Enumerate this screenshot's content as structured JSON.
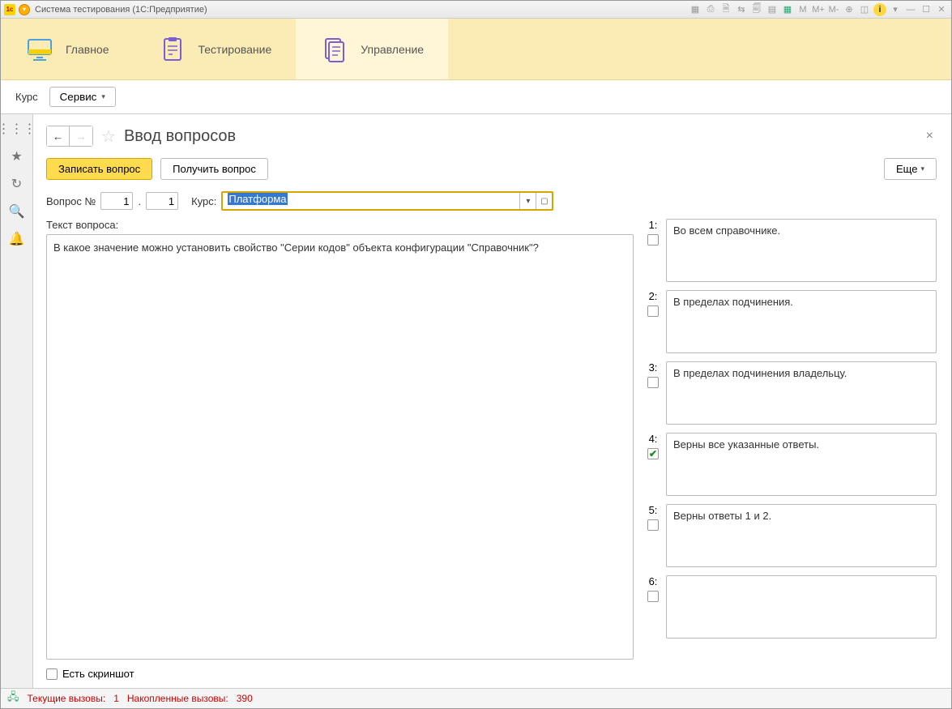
{
  "window": {
    "title": "Система тестирования  (1С:Предприятие)"
  },
  "titlebar_icons": {
    "m": "M",
    "mplus": "M+",
    "mminus": "M-"
  },
  "nav": {
    "items": [
      {
        "label": "Главное"
      },
      {
        "label": "Тестирование"
      },
      {
        "label": "Управление"
      }
    ]
  },
  "subbar": {
    "course": "Курс",
    "service": "Сервис"
  },
  "page": {
    "title": "Ввод вопросов",
    "save_btn": "Записать вопрос",
    "get_btn": "Получить вопрос",
    "more_btn": "Еще"
  },
  "form": {
    "q_label": "Вопрос №",
    "q_num1": "1",
    "dot": ".",
    "q_num2": "1",
    "course_label": "Курс:",
    "course_value": "Платформа",
    "text_label": "Текст вопроса:",
    "text_value": "В какое значение можно установить свойство \"Серии кодов\" объекта конфигурации \"Справочник\"?",
    "screenshot_label": "Есть скриншот"
  },
  "answers": [
    {
      "num": "1:",
      "text": "Во всем справочнике.",
      "checked": false
    },
    {
      "num": "2:",
      "text": "В пределах подчинения.",
      "checked": false
    },
    {
      "num": "3:",
      "text": "В пределах подчинения владельцу.",
      "checked": false
    },
    {
      "num": "4:",
      "text": "Верны все указанные ответы.",
      "checked": true
    },
    {
      "num": "5:",
      "text": "Верны ответы 1 и 2.",
      "checked": false
    },
    {
      "num": "6:",
      "text": "",
      "checked": false
    }
  ],
  "status": {
    "current_label": "Текущие вызовы:",
    "current_val": "1",
    "accum_label": "Накопленные вызовы:",
    "accum_val": "390"
  }
}
